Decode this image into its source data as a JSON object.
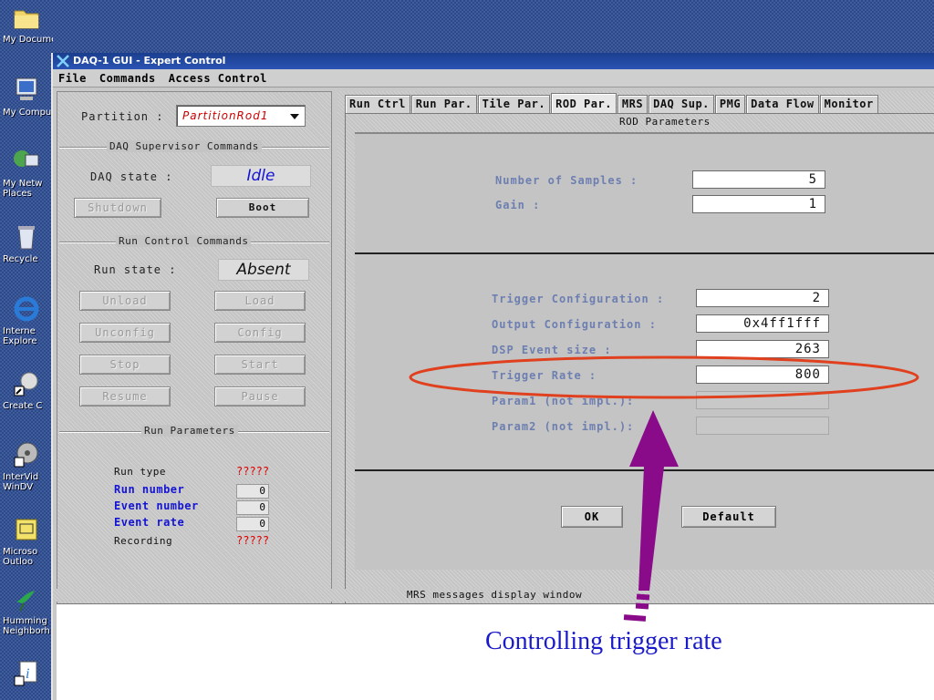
{
  "desktop": {
    "icons": [
      {
        "label": "My Documents",
        "icon": "folder-icon"
      },
      {
        "label": "My Compu",
        "icon": "computer-icon"
      },
      {
        "label": "My Netw Places",
        "icon": "network-icon"
      },
      {
        "label": "Recycle",
        "icon": "recycle-bin-icon"
      },
      {
        "label": "Interne Explore",
        "icon": "internet-explorer-icon"
      },
      {
        "label": "Create C",
        "icon": "shortcut-icon"
      },
      {
        "label": "InterVid WinDV",
        "icon": "film-reel-icon"
      },
      {
        "label": "Microso Outloo",
        "icon": "outlook-icon"
      },
      {
        "label": "Humming Neighborh",
        "icon": "hummingbird-icon"
      },
      {
        "label": "",
        "icon": "info-shortcut-icon"
      }
    ]
  },
  "window": {
    "title": "DAQ-1 GUI - Expert Control",
    "menu": [
      "File",
      "Commands",
      "Access Control"
    ]
  },
  "left_panel": {
    "partition_label": "Partition :",
    "partition_value": "PartitionRod1",
    "daq_supervisor": {
      "title": "DAQ Supervisor Commands",
      "state_label": "DAQ state :",
      "state_value": "Idle",
      "shutdown_label": "Shutdown",
      "boot_label": "Boot"
    },
    "run_control": {
      "title": "Run Control Commands",
      "state_label": "Run state :",
      "state_value": "Absent",
      "buttons": {
        "unload": "Unload",
        "load": "Load",
        "unconfig": "Unconfig",
        "config": "Config",
        "stop": "Stop",
        "start": "Start",
        "resume": "Resume",
        "pause": "Pause"
      }
    },
    "run_parameters": {
      "title": "Run Parameters",
      "rows": [
        {
          "label": "Run type",
          "value": "?????"
        },
        {
          "label": "Run number",
          "value": "0"
        },
        {
          "label": "Event number",
          "value": "0"
        },
        {
          "label": "Event rate",
          "value": "0"
        },
        {
          "label": "Recording",
          "value": "?????"
        }
      ]
    }
  },
  "tabs": [
    "Run Ctrl",
    "Run Par.",
    "Tile Par.",
    "ROD Par.",
    "MRS",
    "DAQ Sup.",
    "PMG",
    "Data Flow",
    "Monitor"
  ],
  "active_tab": "ROD Par.",
  "rod_params": {
    "title": "ROD Parameters",
    "section1": [
      {
        "label": "Number of Samples :",
        "value": "5"
      },
      {
        "label": "Gain :",
        "value": "1"
      }
    ],
    "section2": [
      {
        "label": "Trigger Configuration :",
        "value": "2"
      },
      {
        "label": "Output Configuration :",
        "value": "0x4ff1fff"
      },
      {
        "label": "DSP Event size :",
        "value": "263"
      },
      {
        "label": "Trigger Rate :",
        "value": "800"
      },
      {
        "label": "Param1 (not impl.):",
        "value": ""
      },
      {
        "label": "Param2 (not impl.):",
        "value": ""
      }
    ],
    "ok_label": "OK",
    "default_label": "Default"
  },
  "mrs": {
    "title": "MRS messages display window"
  },
  "annotation": {
    "text": "Controlling trigger rate",
    "ellipse_color": "#e0401e",
    "arrow_color": "#8a0b8a"
  }
}
